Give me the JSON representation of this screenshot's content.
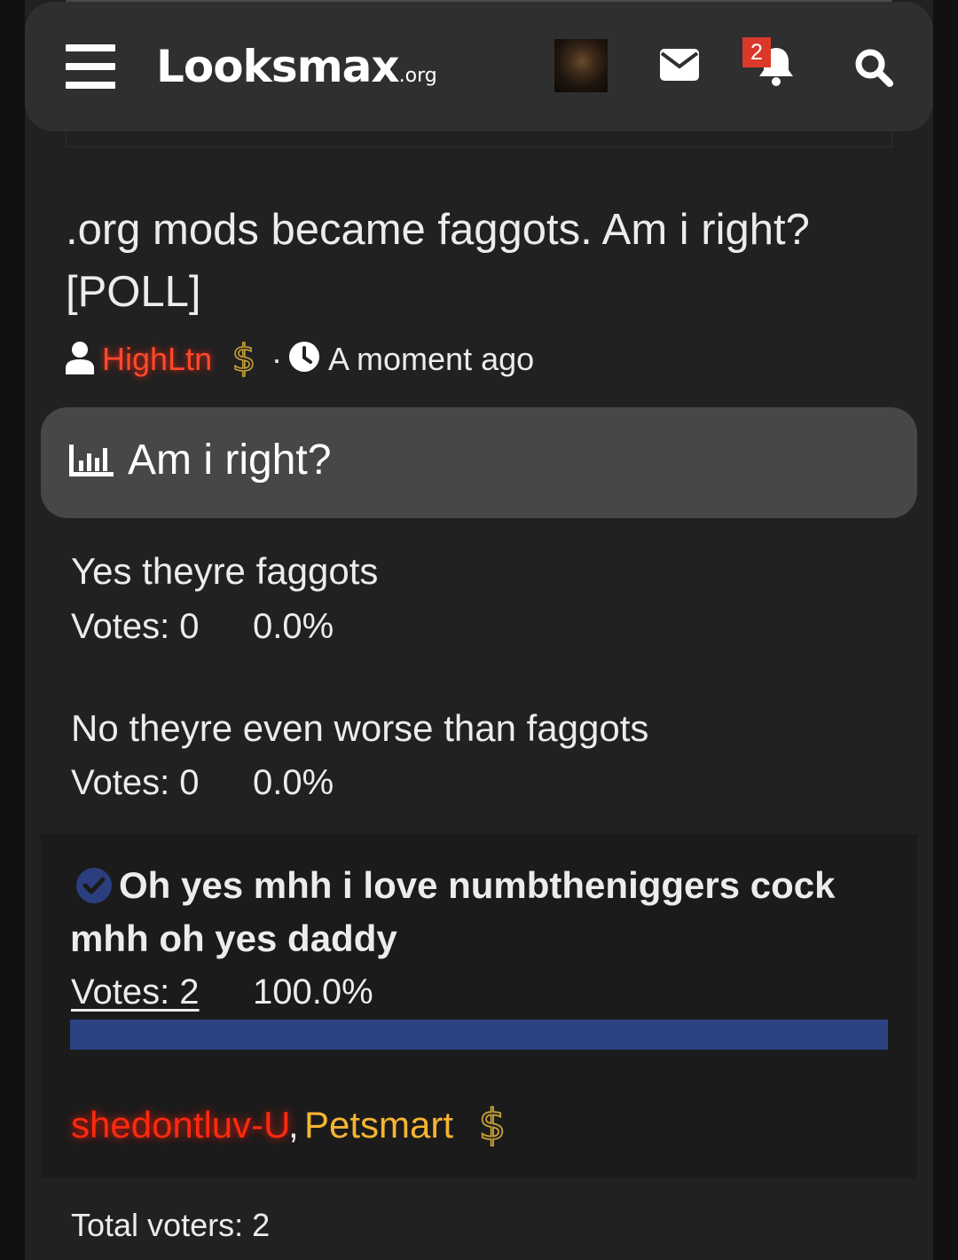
{
  "header": {
    "logo_main": "Looksmax",
    "logo_suffix": ".org",
    "notification_count": "2"
  },
  "thread": {
    "title": ".org mods became faggots. Am i right? [POLL]",
    "author": "HighLtn",
    "separator": "·",
    "time": "A moment ago"
  },
  "poll": {
    "question": "Am i right?",
    "options": [
      {
        "label": "Yes theyre faggots",
        "votes": "Votes: 0",
        "percent": "0.0%"
      },
      {
        "label": "No theyre even worse than faggots",
        "votes": "Votes: 0",
        "percent": "0.0%"
      },
      {
        "label": "Oh yes mhh i love numbtheniggers cock mhh oh yes daddy",
        "votes": "Votes: 2",
        "percent": "100.0%",
        "fill_fraction": 1.0,
        "selected": true
      }
    ],
    "voters": {
      "first": "shedontluv-U",
      "comma": ",",
      "second": "Petsmart"
    },
    "total_voters": "Total voters: 2"
  },
  "colors": {
    "background": "#111111",
    "panel": "#212121",
    "header": "#2f2f2f",
    "poll_header": "#474747",
    "bar": "#2c4282",
    "author_red": "#ff4a2a",
    "voter_gold": "#f5b432",
    "badge_red": "#d8392b"
  },
  "icons": [
    "menu-icon",
    "envelope-icon",
    "bell-icon",
    "search-icon",
    "user-icon",
    "dollar-icon",
    "clock-icon",
    "bar-chart-icon",
    "check-circle-icon"
  ]
}
